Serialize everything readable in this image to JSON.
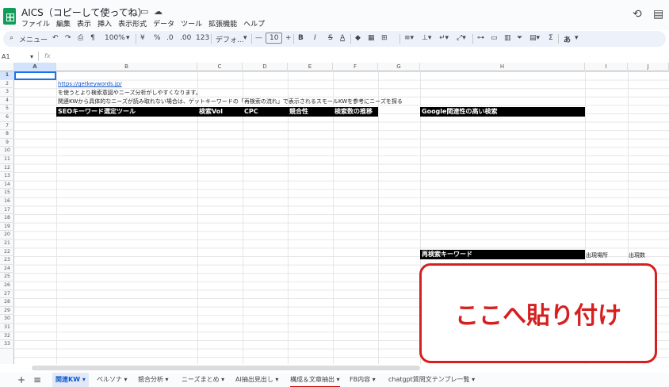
{
  "doc": {
    "title": "AICS（コピーして使ってね）"
  },
  "menu": [
    "ファイル",
    "編集",
    "表示",
    "挿入",
    "表示形式",
    "データ",
    "ツール",
    "拡張機能",
    "ヘルプ"
  ],
  "toolbar": {
    "search": "メニュー",
    "zoom": "100%",
    "currency": "¥",
    "percent": "%",
    "dec1": ".0",
    "dec2": ".00",
    "fmt": "123",
    "font": "デフォ...",
    "size": "10",
    "bold": "B",
    "italic": "I",
    "strike": "S",
    "color": "A",
    "lang": "あ"
  },
  "namebox": "A1",
  "fx": "fx",
  "columns": [
    "A",
    "B",
    "C",
    "D",
    "E",
    "F",
    "G",
    "H",
    "I",
    "J"
  ],
  "rows": [
    "1",
    "2",
    "3",
    "4",
    "5",
    "6",
    "7",
    "8",
    "9",
    "10",
    "11",
    "12",
    "13",
    "14",
    "15",
    "16",
    "17",
    "18",
    "19",
    "20",
    "21",
    "22",
    "23",
    "24",
    "25",
    "26",
    "27",
    "28",
    "29",
    "30",
    "31",
    "32",
    "33"
  ],
  "cells": {
    "b2": "https://getkeywords.jp/",
    "b3": "を使うとより検索意図やニーズ分析がしやすくなります。",
    "b4": "関連KWから具体的なニーズが読み取れない場合は、ゲットキーワードの「再検索の流れ」で表示されるスモールKWを参考にニーズを探る"
  },
  "headers": {
    "b5": "SEOキーワード選定ツール",
    "c5": "検索Vol",
    "d5": "CPC",
    "e5": "競合性",
    "f5": "検索数の推移",
    "h5": "Google関連性の高い検索",
    "h21": "再検索キーワード",
    "i21": "出現場所",
    "j21": "出現数"
  },
  "paste_label": "ここへ貼り付け",
  "tabs": [
    "関連KW",
    "ペルソナ",
    "競合分析",
    "ニーズまとめ",
    "AI抽出見出し",
    "構成＆文章抽出",
    "FB内容",
    "chatgpt質問文テンプレ一覧"
  ],
  "icons": {
    "add": "+",
    "list": "≡"
  }
}
